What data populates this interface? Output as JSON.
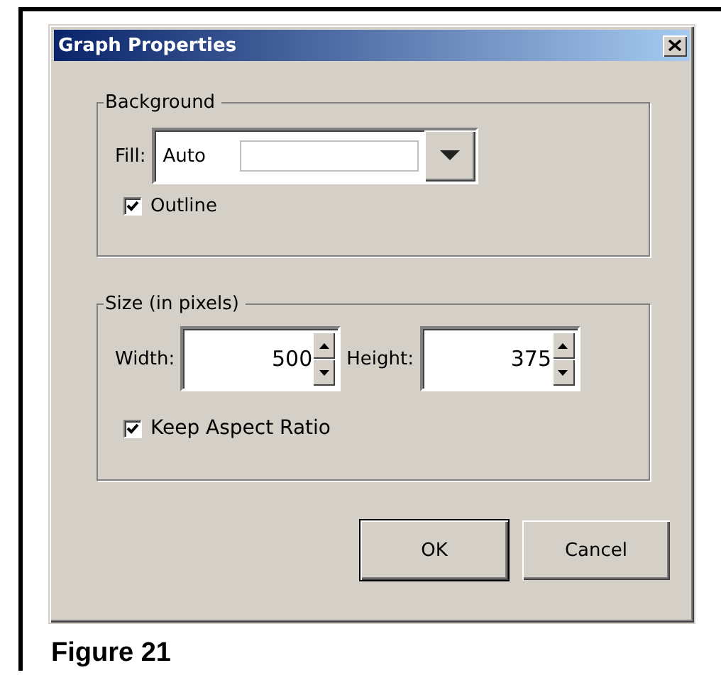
{
  "window": {
    "title": "Graph Properties"
  },
  "background_group": {
    "title": "Background",
    "fill": {
      "label": "Fill:",
      "value": "Auto"
    },
    "outline": {
      "label": "Outline",
      "checked": true
    }
  },
  "size_group": {
    "title": "Size (in pixels)",
    "width": {
      "label": "Width:",
      "value": "500"
    },
    "height": {
      "label": "Height:",
      "value": "375"
    },
    "keep_aspect": {
      "label": "Keep Aspect Ratio",
      "checked": true
    }
  },
  "buttons": [
    {
      "label": "OK",
      "kind": "default"
    },
    {
      "label": "Cancel",
      "kind": "normal"
    }
  ],
  "figure_caption": "Figure 21"
}
